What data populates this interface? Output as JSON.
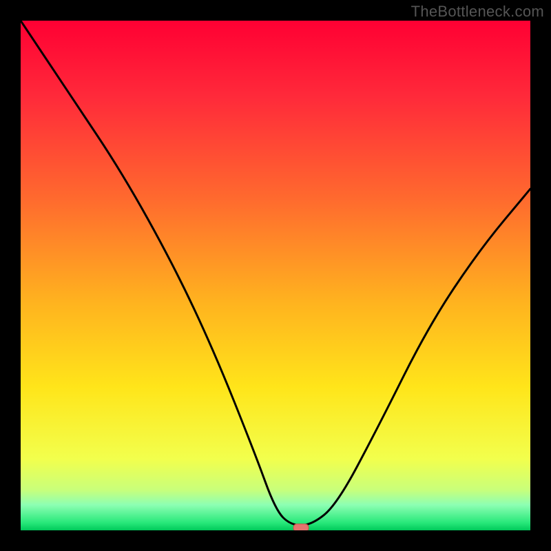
{
  "watermark": "TheBottleneck.com",
  "chart_data": {
    "type": "line",
    "title": "",
    "xlabel": "",
    "ylabel": "",
    "x_norm_range": [
      0,
      1
    ],
    "y_norm_range": [
      0,
      1
    ],
    "grid": false,
    "legend": false,
    "curve_x_norm": [
      0.0,
      0.1,
      0.2,
      0.3,
      0.38,
      0.46,
      0.5,
      0.53,
      0.57,
      0.62,
      0.7,
      0.8,
      0.9,
      1.0
    ],
    "curve_y_norm": [
      1.0,
      0.85,
      0.7,
      0.52,
      0.35,
      0.15,
      0.04,
      0.01,
      0.01,
      0.05,
      0.2,
      0.4,
      0.55,
      0.67
    ],
    "optimum_marker": {
      "x_norm": 0.55,
      "y_norm": 0.005
    },
    "background_gradient_stops": [
      {
        "offset": 0.0,
        "color": "#ff0033"
      },
      {
        "offset": 0.15,
        "color": "#ff2a3a"
      },
      {
        "offset": 0.35,
        "color": "#ff6a2e"
      },
      {
        "offset": 0.55,
        "color": "#ffb21f"
      },
      {
        "offset": 0.72,
        "color": "#ffe51a"
      },
      {
        "offset": 0.86,
        "color": "#f2ff4d"
      },
      {
        "offset": 0.92,
        "color": "#c9ff7a"
      },
      {
        "offset": 0.95,
        "color": "#8dffb3"
      },
      {
        "offset": 0.985,
        "color": "#28e87a"
      },
      {
        "offset": 1.0,
        "color": "#00c95a"
      }
    ],
    "colors": {
      "curve": "#000000",
      "marker_fill": "#e6746e",
      "marker_stroke": "#c85048"
    }
  }
}
